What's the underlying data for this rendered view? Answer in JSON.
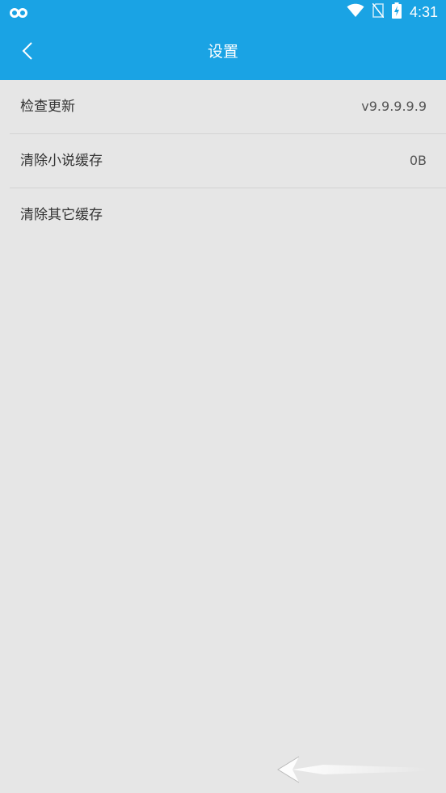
{
  "status_bar": {
    "time": "4:31",
    "left_icon": "infinity-link-icon",
    "icons": [
      "wifi-icon",
      "no-sim-icon",
      "battery-charging-icon"
    ]
  },
  "app_bar": {
    "title": "设置",
    "back_icon": "chevron-left-icon",
    "color": "#1aa3e4"
  },
  "settings": {
    "items": [
      {
        "label": "检查更新",
        "value": "v9.9.9.9.9"
      },
      {
        "label": "清除小说缓存",
        "value": "0B"
      },
      {
        "label": "清除其它缓存",
        "value": ""
      }
    ]
  },
  "colors": {
    "background": "#e6e6e6",
    "divider": "#d3d3d3",
    "text_primary": "#333333",
    "text_secondary": "#555555"
  }
}
